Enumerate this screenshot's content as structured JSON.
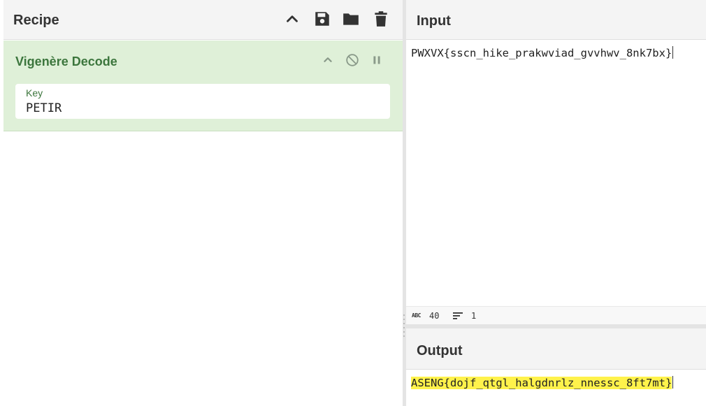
{
  "recipe": {
    "title": "Recipe",
    "icons": [
      "chevron-up-icon",
      "save-icon",
      "folder-icon",
      "trash-icon"
    ]
  },
  "operation": {
    "name": "Vigenère Decode",
    "key_label": "Key",
    "key_value": "PETIR",
    "colors": {
      "background": "#dff0d8",
      "title": "#3c763d"
    }
  },
  "input": {
    "title": "Input",
    "text": "PWXVX{sscn_hike_prakwviad_gvvhwv_8nk7bx}"
  },
  "status": {
    "abc_label": "ABC",
    "char_count": "40",
    "line_count": "1"
  },
  "output": {
    "title": "Output",
    "text": "ASENG{dojf_qtgl_halgdnrlz_nnessc_8ft7mt}",
    "highlight_color": "#fff24b"
  }
}
